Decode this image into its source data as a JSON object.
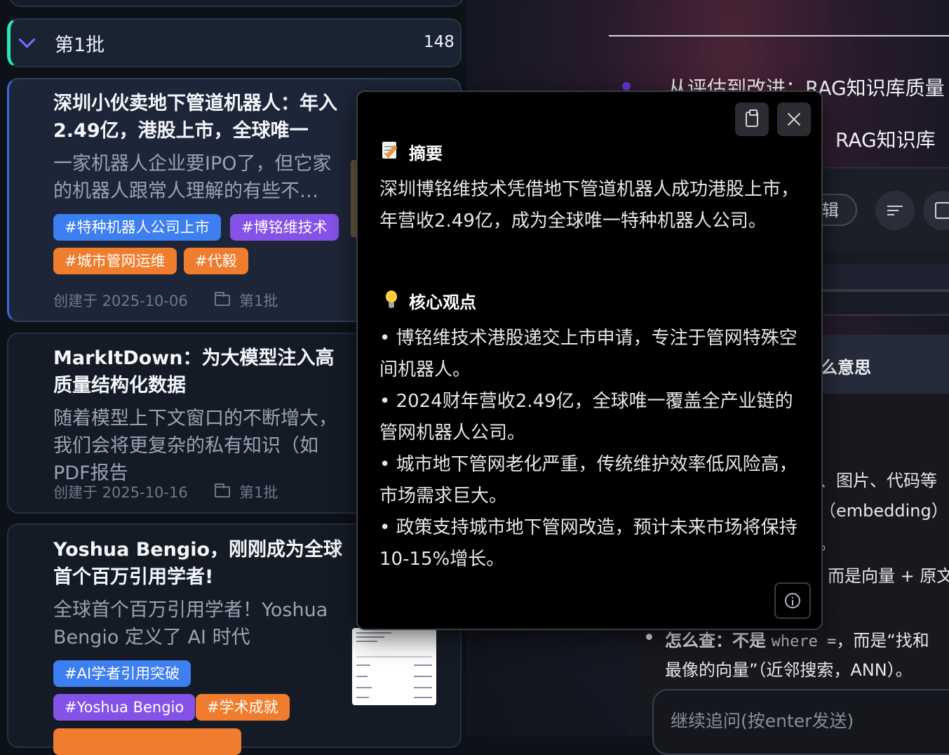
{
  "background": {
    "title_line1": "从评估到改进：RAG知识库质量",
    "title_line2": "：RAG知识库",
    "edit_label": "辑",
    "chat_question": "么意思",
    "chat_lines": [
      {
        "text": "、图片、代码等"
      },
      {
        "text": "（embedding）"
      },
      {
        "text": "。"
      },
      {
        "text": "而是向量 + 原文"
      }
    ],
    "chat_bullet_prefix": "怎么查：不是",
    "chat_bullet_code": "where =",
    "chat_bullet_suffix": "，而是“找和",
    "chat_bullet_line2": "最像的向量”（近邻搜索，ANN）。",
    "input_placeholder": "继续追问(按enter发送)"
  },
  "group": {
    "name": "第1批",
    "count": "148"
  },
  "cards": [
    {
      "title": "深圳小伙卖地下管道机器人：年入2.49亿，港股上市，全球唯一",
      "summary": "一家机器人企业要IPO了，但它家的机器人跟常人理解的有些不…",
      "tags": [
        "#特种机器人公司上市",
        "#博铭维技术",
        "#城市管网运维",
        "#代毅"
      ],
      "created": "创建于 2025-10-06",
      "group": "第1批"
    },
    {
      "title": "MarkItDown：为大模型注入高质量结构化数据",
      "summary": "随着模型上下文窗口的不断增大，我们会将更复杂的私有知识（如PDF报告",
      "created": "创建于 2025-10-16",
      "group": "第1批"
    },
    {
      "title": "Yoshua Bengio，刚刚成为全球首个百万引用学者!",
      "summary": "全球首个百万引用学者！Yoshua Bengio 定义了 AI 时代",
      "tags": [
        "#AI学者引用突破",
        "#Yoshua Bengio",
        "#学术成就"
      ]
    }
  ],
  "popup": {
    "summary_title": "摘要",
    "summary_text": "深圳博铭维技术凭借地下管道机器人成功港股上市，年营收2.49亿，成为全球唯一特种机器人公司。",
    "points_title": "核心观点",
    "points": [
      "• 博铭维技术港股递交上市申请，专注于管网特殊空间机器人。",
      "• 2024财年营收2.49亿，全球唯一覆盖全产业链的管网机器人公司。",
      "• 城市地下管网老化严重，传统维护效率低风险高，市场需求巨大。",
      "• 政策支持城市地下管网改造，预计未来市场将保持10-15%增长。"
    ]
  },
  "colors": {
    "accent_teal": "#2ee6b6",
    "accent_purple": "#7d6dff",
    "tag_blue": "#3d7ef0",
    "tag_purple": "#8552e8",
    "tag_orange": "#f07d2e"
  }
}
